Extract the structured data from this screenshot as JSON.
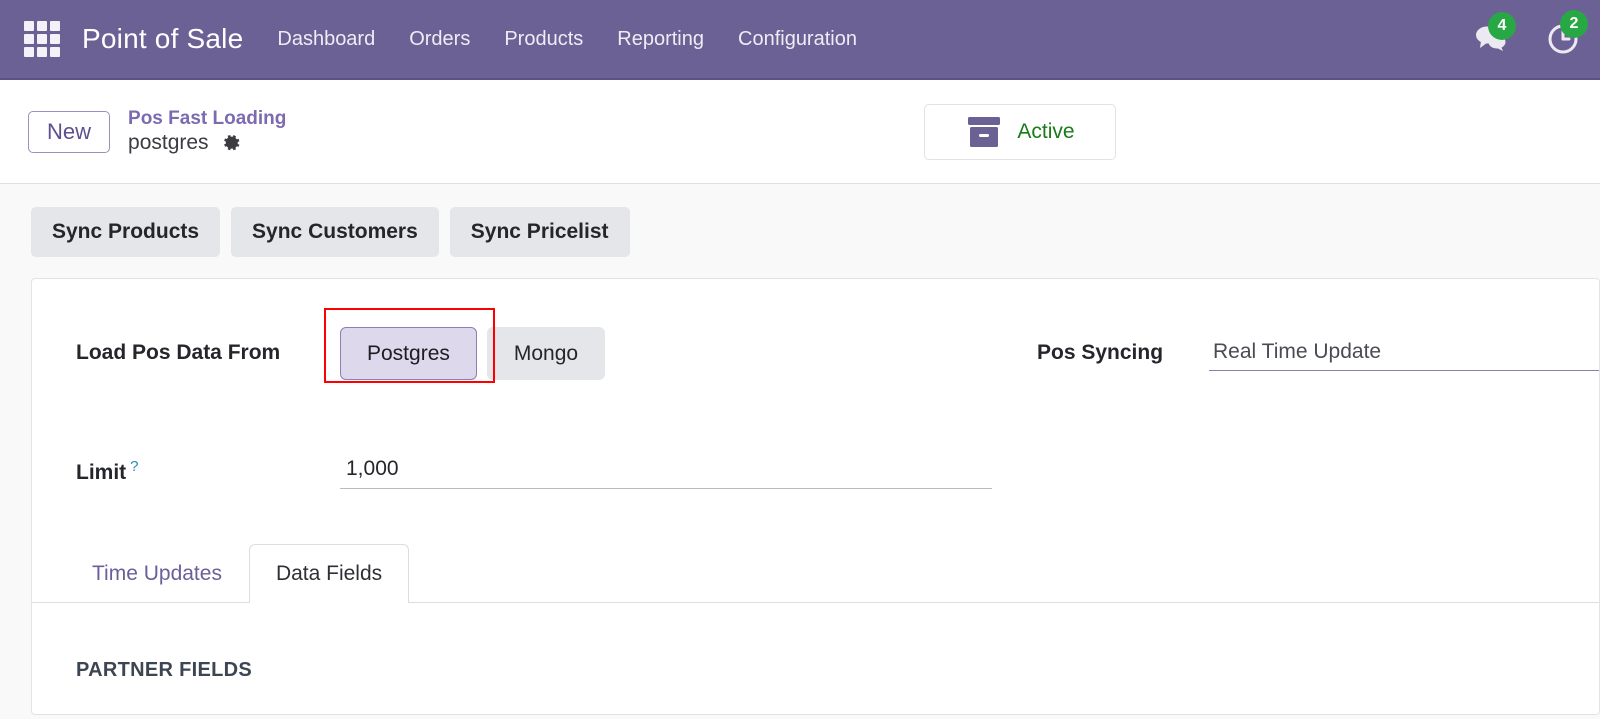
{
  "navbar": {
    "apps_icon": "apps-grid-icon",
    "brand": "Point of Sale",
    "menu": [
      {
        "label": "Dashboard"
      },
      {
        "label": "Orders"
      },
      {
        "label": "Products"
      },
      {
        "label": "Reporting"
      },
      {
        "label": "Configuration"
      }
    ],
    "messages_icon": "messages-icon",
    "messages_count": "4",
    "activities_icon": "clock-activity-icon",
    "activities_count": "2",
    "background_color": "#6c6194"
  },
  "control_panel": {
    "new_label": "New",
    "breadcrumb_parent": "Pos Fast Loading",
    "record_name": "postgres",
    "settings_icon": "gear-icon",
    "stat_button": {
      "icon": "archive-box-icon",
      "label": "Active",
      "label_color": "#1a7a1a"
    }
  },
  "button_box": [
    {
      "label": "Sync Products"
    },
    {
      "label": "Sync Customers"
    },
    {
      "label": "Sync Pricelist"
    }
  ],
  "form": {
    "load_from": {
      "label": "Load Pos Data From",
      "options": [
        {
          "label": "Postgres",
          "selected": true
        },
        {
          "label": "Mongo",
          "selected": false
        }
      ],
      "highlight_color": "#ff0000"
    },
    "limit": {
      "label": "Limit",
      "help_icon": "question-mark-icon",
      "value": "1,000"
    },
    "pos_syncing": {
      "label": "Pos Syncing",
      "value": "Real Time Update"
    }
  },
  "notebook": {
    "tabs": [
      {
        "label": "Time Updates",
        "active": false
      },
      {
        "label": "Data Fields",
        "active": true
      }
    ],
    "section_title": "PARTNER FIELDS"
  }
}
